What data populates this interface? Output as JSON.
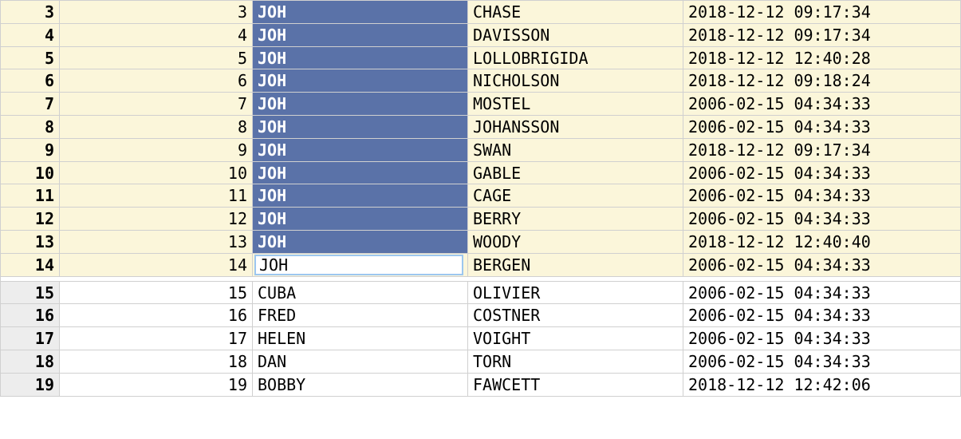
{
  "rows": [
    {
      "n": 3,
      "id": 3,
      "first": "JOH",
      "last": "CHASE",
      "ts": "2018-12-12 09:17:34",
      "zone": "hl",
      "firstState": "sel"
    },
    {
      "n": 4,
      "id": 4,
      "first": "JOH",
      "last": "DAVISSON",
      "ts": "2018-12-12 09:17:34",
      "zone": "hl",
      "firstState": "sel"
    },
    {
      "n": 5,
      "id": 5,
      "first": "JOH",
      "last": "LOLLOBRIGIDA",
      "ts": "2018-12-12 12:40:28",
      "zone": "hl",
      "firstState": "sel"
    },
    {
      "n": 6,
      "id": 6,
      "first": "JOH",
      "last": "NICHOLSON",
      "ts": "2018-12-12 09:18:24",
      "zone": "hl",
      "firstState": "sel"
    },
    {
      "n": 7,
      "id": 7,
      "first": "JOH",
      "last": "MOSTEL",
      "ts": "2006-02-15 04:34:33",
      "zone": "hl",
      "firstState": "sel"
    },
    {
      "n": 8,
      "id": 8,
      "first": "JOH",
      "last": "JOHANSSON",
      "ts": "2006-02-15 04:34:33",
      "zone": "hl",
      "firstState": "sel"
    },
    {
      "n": 9,
      "id": 9,
      "first": "JOH",
      "last": "SWAN",
      "ts": "2018-12-12 09:17:34",
      "zone": "hl",
      "firstState": "sel"
    },
    {
      "n": 10,
      "id": 10,
      "first": "JOH",
      "last": "GABLE",
      "ts": "2006-02-15 04:34:33",
      "zone": "hl",
      "firstState": "sel"
    },
    {
      "n": 11,
      "id": 11,
      "first": "JOH",
      "last": "CAGE",
      "ts": "2006-02-15 04:34:33",
      "zone": "hl",
      "firstState": "sel"
    },
    {
      "n": 12,
      "id": 12,
      "first": "JOH",
      "last": "BERRY",
      "ts": "2006-02-15 04:34:33",
      "zone": "hl",
      "firstState": "sel"
    },
    {
      "n": 13,
      "id": 13,
      "first": "JOH",
      "last": "WOODY",
      "ts": "2018-12-12 12:40:40",
      "zone": "hl",
      "firstState": "sel"
    },
    {
      "n": 14,
      "id": 14,
      "first": "JOH",
      "last": "BERGEN",
      "ts": "2006-02-15 04:34:33",
      "zone": "hl",
      "firstState": "edit"
    },
    {
      "n": 15,
      "id": 15,
      "first": "CUBA",
      "last": "OLIVIER",
      "ts": "2006-02-15 04:34:33",
      "zone": "plain",
      "firstState": "norm"
    },
    {
      "n": 16,
      "id": 16,
      "first": "FRED",
      "last": "COSTNER",
      "ts": "2006-02-15 04:34:33",
      "zone": "plain",
      "firstState": "norm"
    },
    {
      "n": 17,
      "id": 17,
      "first": "HELEN",
      "last": "VOIGHT",
      "ts": "2006-02-15 04:34:33",
      "zone": "plain",
      "firstState": "norm"
    },
    {
      "n": 18,
      "id": 18,
      "first": "DAN",
      "last": "TORN",
      "ts": "2006-02-15 04:34:33",
      "zone": "plain",
      "firstState": "norm"
    },
    {
      "n": 19,
      "id": 19,
      "first": "BOBBY",
      "last": "FAWCETT",
      "ts": "2018-12-12 12:42:06",
      "zone": "plain",
      "firstState": "norm"
    }
  ],
  "colors": {
    "highlightBg": "#fbf6da",
    "selectionBg": "#5a72a8",
    "editBorder": "#9cc7ef",
    "gutterBg": "#ededed"
  }
}
